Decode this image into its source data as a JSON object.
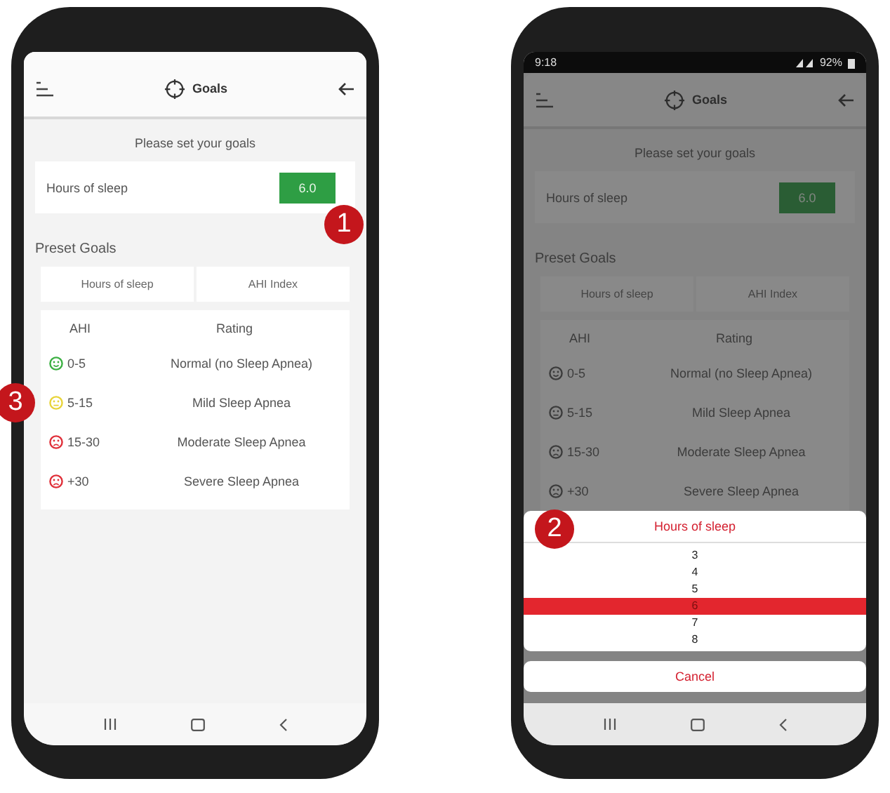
{
  "phones": [
    {
      "dimmed": false,
      "header": {
        "title": "Goals"
      },
      "prompt": "Please set your goals",
      "goal": {
        "label": "Hours of sleep",
        "value": "6.0",
        "callout": "1"
      },
      "preset_heading": "Preset Goals",
      "preset_tabs": [
        "Hours of sleep",
        "AHI Index"
      ],
      "table": {
        "columns": [
          "AHI",
          "Rating"
        ],
        "rows": [
          {
            "kind": "happy",
            "color": "#3cb043",
            "ahi": "0-5",
            "rating": "Normal (no Sleep Apnea)"
          },
          {
            "kind": "neutral",
            "color": "#e8d43a",
            "ahi": "5-15",
            "rating": "Mild Sleep Apnea",
            "callout": "3"
          },
          {
            "kind": "sad",
            "color": "#e0303a",
            "ahi": "15-30",
            "rating": "Moderate Sleep Apnea"
          },
          {
            "kind": "sad",
            "color": "#e0303a",
            "ahi": "+30",
            "rating": "Severe Sleep Apnea"
          }
        ]
      }
    },
    {
      "dimmed": true,
      "status_bar": {
        "time": "9:18",
        "battery": "92%"
      },
      "header": {
        "title": "Goals"
      },
      "prompt": "Please set your goals",
      "goal": {
        "label": "Hours of sleep",
        "value": "6.0"
      },
      "preset_heading": "Preset Goals",
      "preset_tabs": [
        "Hours of sleep",
        "AHI Index"
      ],
      "table": {
        "columns": [
          "AHI",
          "Rating"
        ],
        "rows": [
          {
            "kind": "happy",
            "ahi": "0-5",
            "rating": "Normal (no Sleep Apnea)"
          },
          {
            "kind": "neutral",
            "ahi": "5-15",
            "rating": "Mild Sleep Apnea"
          },
          {
            "kind": "sad",
            "ahi": "15-30",
            "rating": "Moderate Sleep Apnea"
          },
          {
            "kind": "sad",
            "ahi": "+30",
            "rating": "Severe Sleep Apnea"
          }
        ]
      },
      "picker": {
        "title": "Hours of sleep",
        "callout": "2",
        "options": [
          {
            "label": "3",
            "selected": false
          },
          {
            "label": "4",
            "selected": false
          },
          {
            "label": "5",
            "selected": false
          },
          {
            "label": "6",
            "selected": true
          },
          {
            "label": "7",
            "selected": false
          },
          {
            "label": "8",
            "selected": false
          }
        ],
        "cancel": "Cancel"
      }
    }
  ]
}
